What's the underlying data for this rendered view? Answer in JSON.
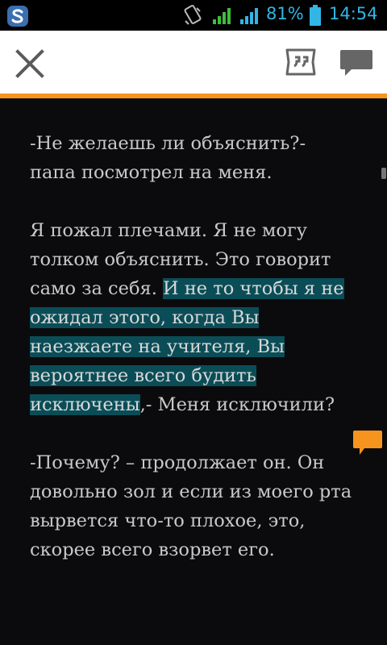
{
  "status_bar": {
    "battery_percent": "81%",
    "time": "14:54",
    "icons": [
      "app-notification-icon",
      "rotation-lock-icon",
      "signal-icon",
      "signal-icon",
      "battery-icon"
    ],
    "accent_color": "#33b5e5"
  },
  "toolbar": {
    "close_icon": "close-icon",
    "quote_icon": "quote-icon",
    "comment_icon": "comment-icon",
    "accent_color": "#f7941e"
  },
  "reader": {
    "paragraphs": [
      {
        "before": "-Не желаешь ли объяснить?- папа посмотрел на меня.",
        "highlight": "",
        "after": ""
      },
      {
        "before": "Я пожал плечами. Я не могу толком объяснить. Это говорит само за себя. ",
        "highlight": "И не то чтобы я не ожидал этого, когда Вы наезжаете на учителя, Вы вероятнее всего будить исключены",
        "after": ",- Меня исключили?"
      },
      {
        "before": "-Почему? – продолжает он. Он довольно зол и если из моего рта вырвется что-то плохое, это, скорее всего взорвет его.",
        "highlight": "",
        "after": ""
      }
    ],
    "highlight_color": "#0a4d57",
    "note_marker_color": "#f7941e"
  }
}
